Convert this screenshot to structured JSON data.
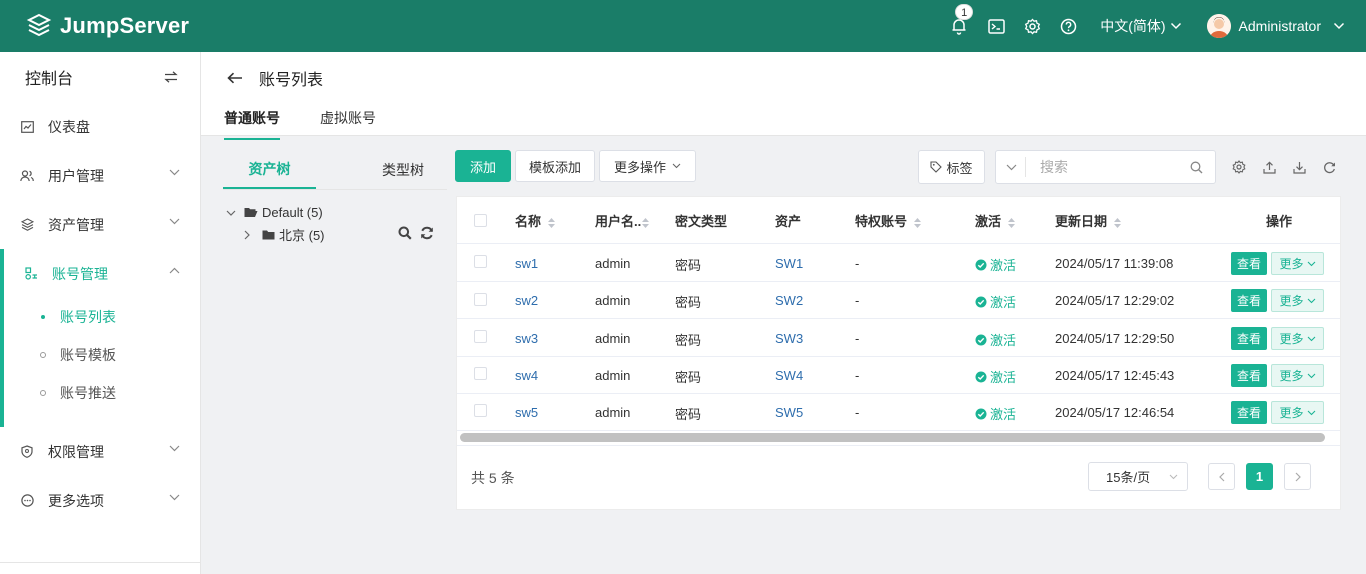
{
  "app": {
    "name": "JumpServer"
  },
  "header": {
    "notification_count": "1",
    "language": "中文(简体)",
    "user": "Administrator",
    "icons": [
      "bell-icon",
      "terminal-icon",
      "settings-icon",
      "help-icon"
    ]
  },
  "sidebar": {
    "title": "控制台",
    "items": [
      {
        "label": "仪表盘",
        "icon": "dashboard-icon"
      },
      {
        "label": "用户管理",
        "icon": "users-icon"
      },
      {
        "label": "资产管理",
        "icon": "assets-icon"
      },
      {
        "label": "账号管理",
        "icon": "accounts-icon",
        "active": true,
        "children": [
          {
            "label": "账号列表",
            "active": true
          },
          {
            "label": "账号模板"
          },
          {
            "label": "账号推送"
          }
        ]
      },
      {
        "label": "权限管理",
        "icon": "shield-icon"
      },
      {
        "label": "更多选项",
        "icon": "more-icon"
      }
    ]
  },
  "page": {
    "title": "账号列表",
    "tabs": [
      "普通账号",
      "虚拟账号"
    ]
  },
  "tree": {
    "tabs": [
      "资产树",
      "类型树"
    ],
    "root": "Default (5)",
    "child": "北京 (5)"
  },
  "toolbar": {
    "add": "添加",
    "template_add": "模板添加",
    "more_actions": "更多操作",
    "tags": "标签",
    "search_placeholder": "搜索"
  },
  "table": {
    "columns": [
      "名称",
      "用户名..",
      "密文类型",
      "资产",
      "特权账号",
      "激活",
      "更新日期",
      "操作"
    ],
    "rows": [
      {
        "name": "sw1",
        "username": "admin",
        "secret_type": "密码",
        "asset": "SW1",
        "privileged": "-",
        "active": "激活",
        "updated": "2024/05/17 11:39:08"
      },
      {
        "name": "sw2",
        "username": "admin",
        "secret_type": "密码",
        "asset": "SW2",
        "privileged": "-",
        "active": "激活",
        "updated": "2024/05/17 12:29:02"
      },
      {
        "name": "sw3",
        "username": "admin",
        "secret_type": "密码",
        "asset": "SW3",
        "privileged": "-",
        "active": "激活",
        "updated": "2024/05/17 12:29:50"
      },
      {
        "name": "sw4",
        "username": "admin",
        "secret_type": "密码",
        "asset": "SW4",
        "privileged": "-",
        "active": "激活",
        "updated": "2024/05/17 12:45:43"
      },
      {
        "name": "sw5",
        "username": "admin",
        "secret_type": "密码",
        "asset": "SW5",
        "privileged": "-",
        "active": "激活",
        "updated": "2024/05/17 12:46:54"
      }
    ],
    "view_label": "查看",
    "more_label": "更多"
  },
  "pagination": {
    "total": "共 5 条",
    "page_size": "15条/页",
    "current_page": "1"
  },
  "colors": {
    "brand": "#1a7d68",
    "accent": "#1ab394",
    "link": "#2e6dad"
  }
}
